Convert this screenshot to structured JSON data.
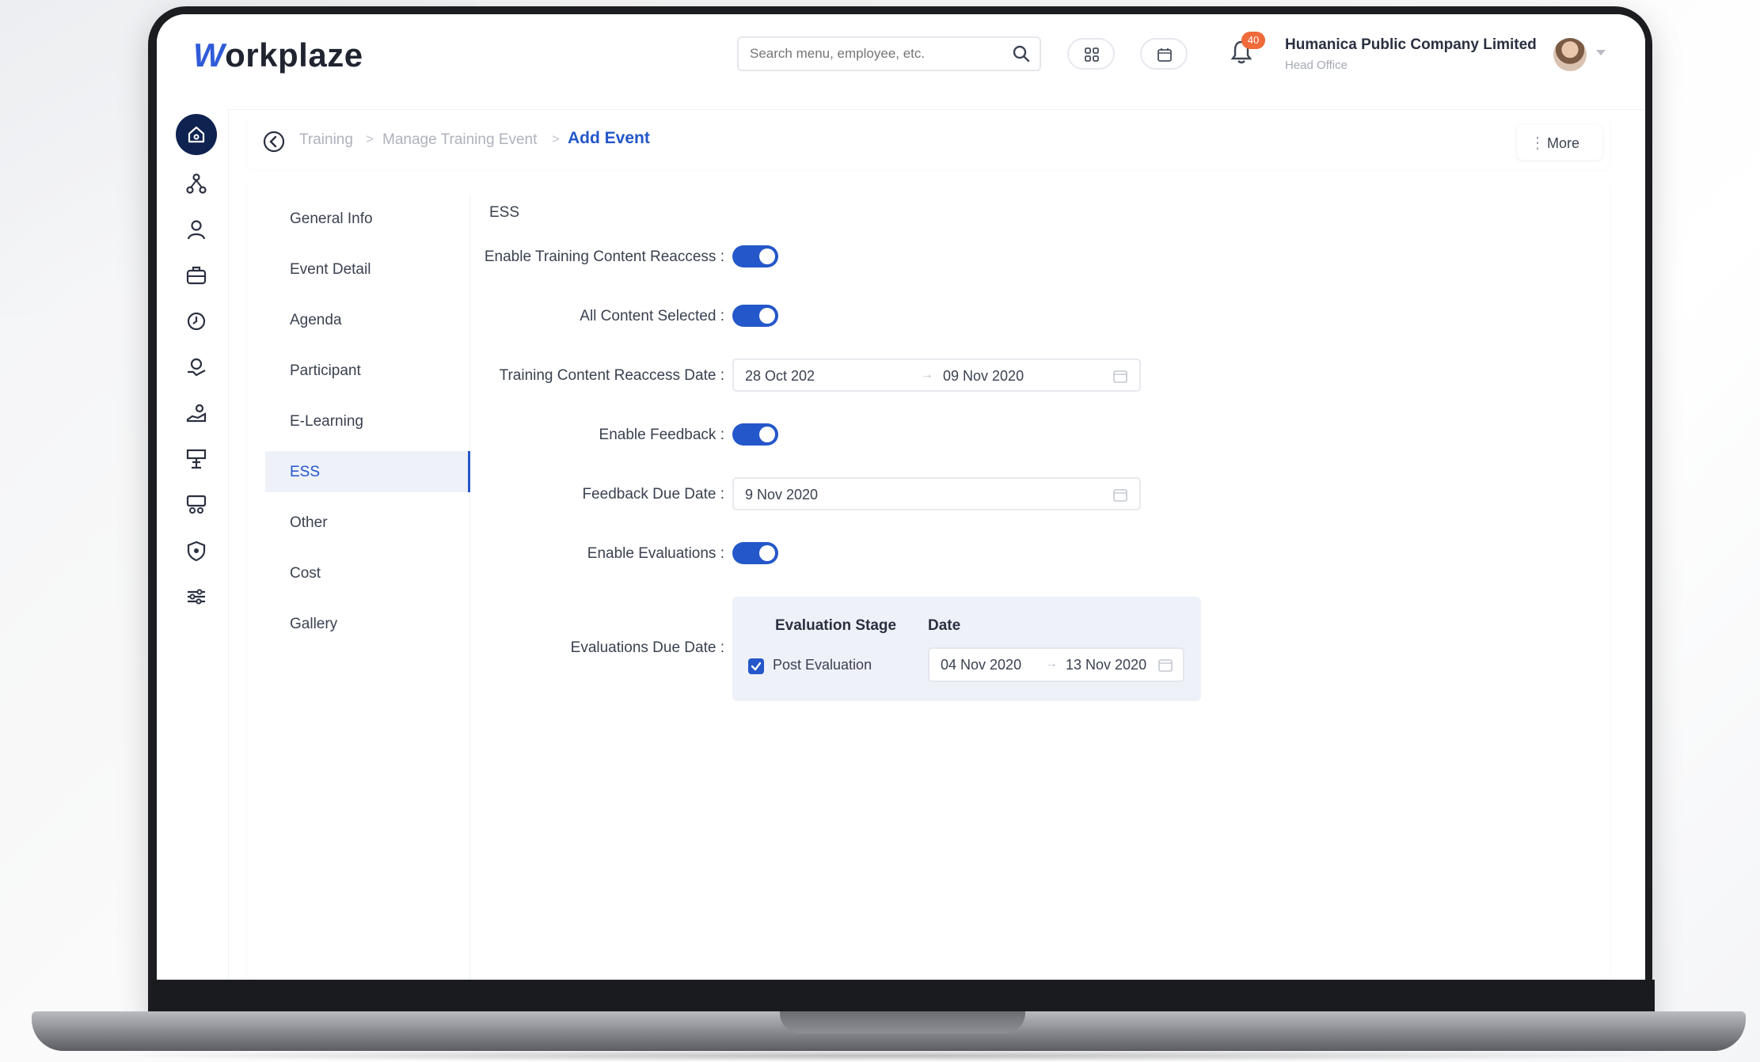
{
  "header": {
    "logo_w": "W",
    "logo_rest": "orkplaze",
    "search_placeholder": "Search menu, employee, etc.",
    "notification_count": "40",
    "company_name": "Humanica Public Company Limited",
    "company_branch": "Head Office"
  },
  "breadcrumb": {
    "items": [
      "Training",
      "Manage Training Event"
    ],
    "separator": ">",
    "current": "Add Event",
    "more_label": "More"
  },
  "sidenav": {
    "items": [
      "General Info",
      "Event Detail",
      "Agenda",
      "Participant",
      "E-Learning",
      "ESS",
      "Other",
      "Cost",
      "Gallery"
    ],
    "active": "ESS"
  },
  "form": {
    "section_title": "ESS",
    "enable_reaccess_label": "Enable Training Content Reaccess :",
    "enable_reaccess": true,
    "all_content_label": "All Content Selected :",
    "all_content": true,
    "reaccess_date_label": "Training Content Reaccess Date :",
    "reaccess_start": "28 Oct 202",
    "reaccess_end": "09 Nov 2020",
    "enable_feedback_label": "Enable Feedback :",
    "enable_feedback": true,
    "feedback_due_label": "Feedback Due Date :",
    "feedback_due": "9 Nov 2020",
    "enable_eval_label": "Enable Evaluations :",
    "enable_eval": true,
    "eval_due_label": "Evaluations Due Date :",
    "eval_table": {
      "col_stage": "Evaluation Stage",
      "col_date": "Date",
      "rows": [
        {
          "stage": "Post Evaluation",
          "checked": true,
          "start": "04 Nov 2020",
          "end": "13 Nov 2020"
        }
      ]
    }
  },
  "colors": {
    "accent": "#2457c9",
    "navy": "#0f2350",
    "badge": "#f06a3a"
  }
}
